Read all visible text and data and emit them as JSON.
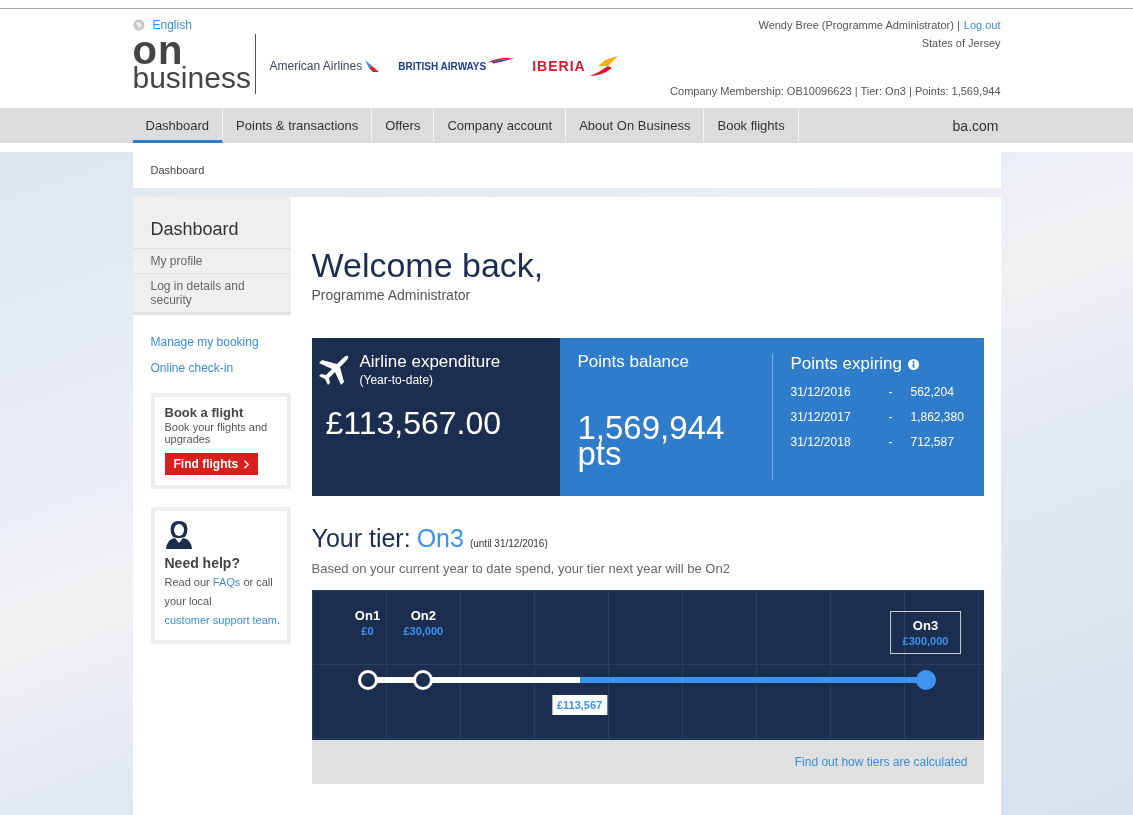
{
  "header": {
    "language": "English",
    "user": "Wendy Bree (Programme Administrator) |",
    "logout": "Log out",
    "location": "States of Jersey",
    "membership": "Company Membership: OB10096623 | Tier: On3 | Points: 1,569,944",
    "logo_top": "on",
    "logo_bottom": "business",
    "partners": [
      {
        "name": "American Airlines",
        "kind": "aa"
      },
      {
        "name": "BRITISH AIRWAYS",
        "kind": "ba"
      },
      {
        "name": "IBERIA",
        "kind": "ib"
      }
    ]
  },
  "nav": [
    {
      "label": "Dashboard",
      "selected": true
    },
    {
      "label": "Points & transactions",
      "selected": false
    },
    {
      "label": "Offers",
      "selected": false
    },
    {
      "label": "Company account",
      "selected": false
    },
    {
      "label": "About On Business",
      "selected": false
    },
    {
      "label": "Book flights",
      "selected": false
    }
  ],
  "nav_right": "ba.com",
  "breadcrumb": "Dashboard",
  "sidebar": {
    "title": "Dashboard",
    "items": [
      {
        "label": "My profile",
        "selected": false
      },
      {
        "label": "Log in details and security",
        "selected": false
      }
    ],
    "links": [
      "Manage my booking",
      "Online check-in"
    ],
    "book": {
      "title": "Book a flight",
      "text": "Book your flights and upgrades",
      "button": "Find flights"
    },
    "help": {
      "title": "Need help?",
      "text_1": "Read our",
      "link_1": "FAQs",
      "text_2": "or call your local",
      "link_2": "customer support team."
    }
  },
  "welcome": {
    "title": "Welcome back,",
    "subtitle": "Programme Administrator"
  },
  "expenditure": {
    "title": "Airline expenditure",
    "subtitle": "(Year-to-date)",
    "amount": "£113,567.00"
  },
  "balance": {
    "title": "Points balance",
    "value": "1,569,944",
    "unit": "pts"
  },
  "expiring": {
    "title": "Points expiring",
    "rows": [
      {
        "date": "31/12/2016",
        "dash": "-",
        "points": "562,204"
      },
      {
        "date": "31/12/2017",
        "dash": "-",
        "points": "1,862,380"
      },
      {
        "date": "31/12/2018",
        "dash": "-",
        "points": "712,587"
      }
    ]
  },
  "tier": {
    "label": "Your tier:",
    "name": "On3",
    "until": "(until 31/12/2016)",
    "note": "Based on your current year to date spend, your tier next year will be On2",
    "milestones": [
      {
        "name": "On1",
        "amount": "£0",
        "selected": false
      },
      {
        "name": "On2",
        "amount": "£30,000",
        "selected": false
      },
      {
        "name": "On3",
        "amount": "£300,000",
        "selected": true
      }
    ],
    "current": {
      "amount": "£113,567",
      "level": 0.38
    },
    "link": "Find out how tiers are calculated"
  }
}
